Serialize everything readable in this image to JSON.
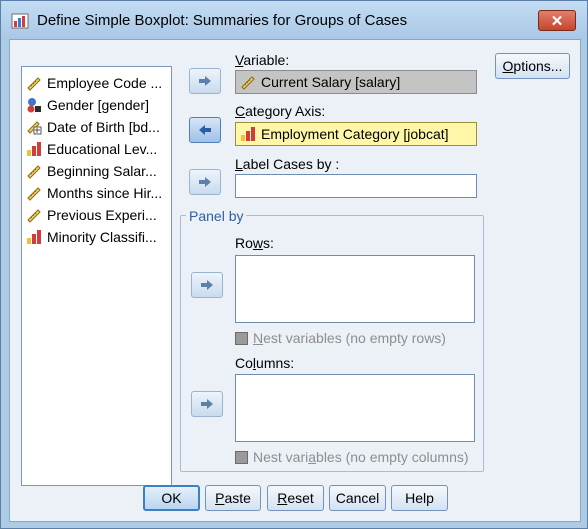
{
  "window": {
    "title": "Define Simple Boxplot: Summaries for Groups of Cases",
    "close_label": "✕"
  },
  "source_list": {
    "items": [
      {
        "label": "Employee Code ...",
        "icon": "scale-ruler-icon"
      },
      {
        "label": "Gender [gender]",
        "icon": "nominal-shapes-icon"
      },
      {
        "label": "Date of Birth [bd...",
        "icon": "date-ruler-icon"
      },
      {
        "label": "Educational Lev...",
        "icon": "ordinal-bars-icon"
      },
      {
        "label": "Beginning Salar...",
        "icon": "scale-ruler-icon"
      },
      {
        "label": "Months since Hir...",
        "icon": "scale-ruler-icon"
      },
      {
        "label": "Previous Experi...",
        "icon": "scale-ruler-icon"
      },
      {
        "label": "Minority Classifi...",
        "icon": "ordinal-bars-icon"
      }
    ]
  },
  "variable": {
    "label_pre": "",
    "label_u": "V",
    "label_post": "ariable:",
    "value": "Current Salary [salary]",
    "icon": "scale-ruler-icon"
  },
  "category_axis": {
    "label_pre": "",
    "label_u": "C",
    "label_post": "ategory Axis:",
    "value": "Employment Category [jobcat]",
    "icon": "ordinal-bars-icon"
  },
  "label_cases": {
    "label_pre": "",
    "label_u": "L",
    "label_post": "abel Cases by :",
    "value": ""
  },
  "panel_by": {
    "title": "Panel by",
    "rows_label_pre": "Ro",
    "rows_label_u": "w",
    "rows_label_post": "s:",
    "nest_rows_pre": "",
    "nest_rows_u": "N",
    "nest_rows_post": "est variables (no empty rows)",
    "columns_label_pre": "Co",
    "columns_label_u": "l",
    "columns_label_post": "umns:",
    "nest_cols_pre": "Nest vari",
    "nest_cols_u": "a",
    "nest_cols_post": "bles (no empty columns)"
  },
  "buttons": {
    "options": "Options...",
    "options_u": "O",
    "options_rest": "ptions...",
    "ok": "OK",
    "paste_u": "P",
    "paste_rest": "aste",
    "reset_u": "R",
    "reset_rest": "eset",
    "cancel": "Cancel",
    "help": "Help"
  },
  "colors": {
    "selected_field": "#fff6a8",
    "disabled_field": "#c4c4c4",
    "title_bar": "#aecbe6",
    "close_button": "#c6452c"
  }
}
